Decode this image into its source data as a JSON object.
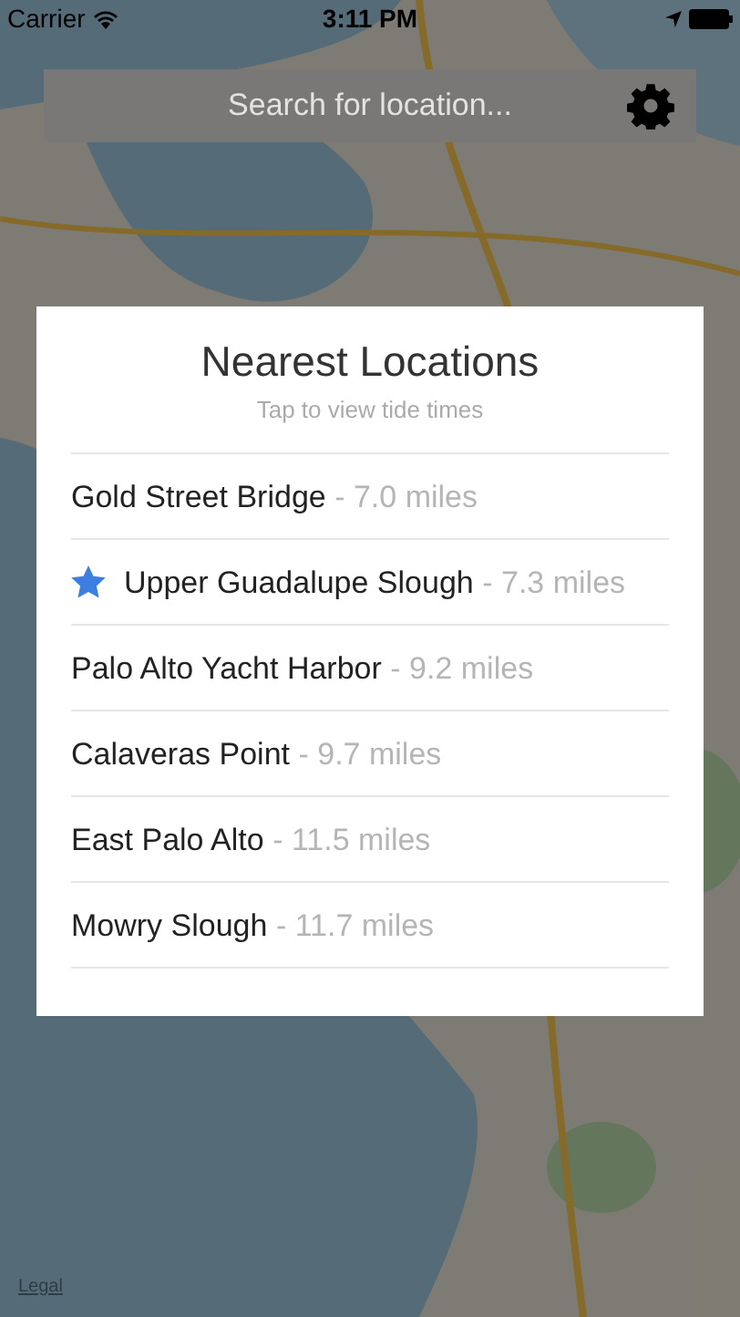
{
  "status_bar": {
    "carrier": "Carrier",
    "time": "3:11 PM"
  },
  "search": {
    "placeholder": "Search for location..."
  },
  "panel": {
    "title": "Nearest Locations",
    "subtitle": "Tap to view tide times",
    "locations": [
      {
        "name": "Gold Street Bridge",
        "distance": "- 7.0 miles",
        "favorite": false
      },
      {
        "name": "Upper Guadalupe Slough",
        "distance": "- 7.3 miles",
        "favorite": true
      },
      {
        "name": "Palo Alto Yacht Harbor",
        "distance": "- 9.2 miles",
        "favorite": false
      },
      {
        "name": "Calaveras Point",
        "distance": "- 9.7 miles",
        "favorite": false
      },
      {
        "name": "East Palo Alto",
        "distance": "- 11.5 miles",
        "favorite": false
      },
      {
        "name": "Mowry Slough",
        "distance": "- 11.7 miles",
        "favorite": false
      }
    ]
  },
  "map_footer": {
    "legal": "Legal"
  }
}
